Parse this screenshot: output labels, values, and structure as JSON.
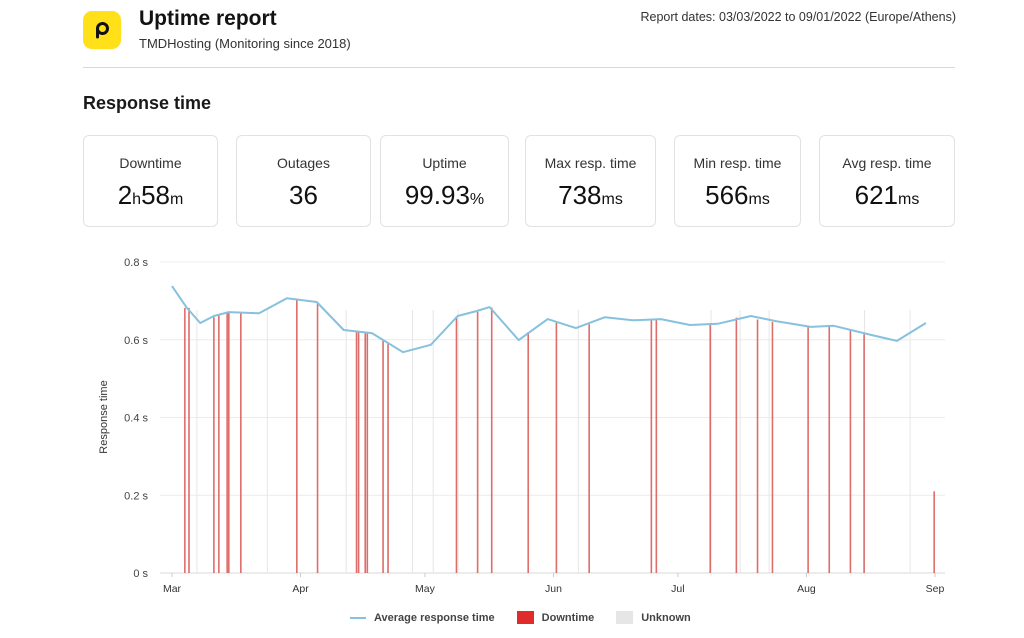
{
  "header": {
    "logo_icon": "pingdom-p-logo-icon",
    "title": "Uptime report",
    "subtitle": "TMDHosting (Monitoring since 2018)",
    "report_dates": "Report dates: 03/03/2022 to 09/01/2022 (Europe/Athens)"
  },
  "section_title": "Response time",
  "cards": [
    {
      "label": "Downtime",
      "parts": [
        {
          "v": "2",
          "u": false
        },
        {
          "v": "h",
          "u": true
        },
        {
          "v": "58",
          "u": false
        },
        {
          "v": "m",
          "u": true
        }
      ]
    },
    {
      "label": "Outages",
      "parts": [
        {
          "v": "36",
          "u": false
        }
      ]
    },
    {
      "label": "Uptime",
      "parts": [
        {
          "v": "99.93",
          "u": false
        },
        {
          "v": "%",
          "u": true
        }
      ]
    },
    {
      "label": "Max resp. time",
      "parts": [
        {
          "v": "738",
          "u": false
        },
        {
          "v": "ms",
          "u": true
        }
      ]
    },
    {
      "label": "Min resp. time",
      "parts": [
        {
          "v": "566",
          "u": false
        },
        {
          "v": "ms",
          "u": true
        }
      ]
    },
    {
      "label": "Avg resp. time",
      "parts": [
        {
          "v": "621",
          "u": false
        },
        {
          "v": "ms",
          "u": true
        }
      ]
    }
  ],
  "colors": {
    "line": "#86c1de",
    "downtime": "#d9534f",
    "downtime_legend": "#e02b2b",
    "unknown": "#e6e6e6",
    "logo": "#ffe019"
  },
  "chart_data": {
    "type": "line",
    "title": "Response time",
    "xlabel": "",
    "ylabel": "Response time",
    "ylim": [
      0,
      0.8
    ],
    "yticks": [
      0,
      0.2,
      0.4,
      0.6,
      0.8
    ],
    "ytick_labels": [
      "0 s",
      "0.2 s",
      "0.4 s",
      "0.6 s",
      "0.8 s"
    ],
    "xlim_days_from_mar1": [
      -3,
      187
    ],
    "xticks": [
      {
        "label": "Mar",
        "day": 0
      },
      {
        "label": "Apr",
        "day": 31
      },
      {
        "label": "May",
        "day": 61
      },
      {
        "label": "Jun",
        "day": 92
      },
      {
        "label": "Jul",
        "day": 122
      },
      {
        "label": "Aug",
        "day": 153
      },
      {
        "label": "Sep",
        "day": 184
      }
    ],
    "grid": true,
    "legend_position": "bottom",
    "legend": [
      "Average response time",
      "Downtime",
      "Unknown"
    ],
    "series": [
      {
        "name": "Average response time",
        "points_day_seconds": [
          [
            0,
            0.738
          ],
          [
            3.6,
            0.682
          ],
          [
            6.8,
            0.643
          ],
          [
            10.1,
            0.661
          ],
          [
            13.7,
            0.671
          ],
          [
            21,
            0.668
          ],
          [
            27.7,
            0.707
          ],
          [
            34.9,
            0.697
          ],
          [
            41.4,
            0.625
          ],
          [
            48.2,
            0.617
          ],
          [
            55.7,
            0.568
          ],
          [
            62.4,
            0.587
          ],
          [
            68.9,
            0.661
          ],
          [
            73.5,
            0.674
          ],
          [
            76.6,
            0.684
          ],
          [
            83.6,
            0.599
          ],
          [
            90.6,
            0.653
          ],
          [
            97.4,
            0.63
          ],
          [
            104.4,
            0.658
          ],
          [
            111.1,
            0.65
          ],
          [
            117.9,
            0.653
          ],
          [
            124.9,
            0.638
          ],
          [
            131.6,
            0.641
          ],
          [
            139.6,
            0.661
          ],
          [
            145.6,
            0.648
          ],
          [
            154.1,
            0.633
          ],
          [
            159.6,
            0.636
          ],
          [
            168.8,
            0.612
          ],
          [
            174.8,
            0.597
          ],
          [
            181.8,
            0.643
          ]
        ]
      }
    ],
    "downtime_events_day": [
      3.1,
      4.1,
      10.1,
      11.3,
      13.3,
      13.7,
      16.6,
      30.1,
      35.1,
      44.5,
      45,
      46.6,
      47.1,
      50.9,
      52.1,
      68.6,
      73.7,
      77.1,
      85.9,
      92.7,
      100.6,
      115.6,
      116.8,
      129.8,
      136.1,
      141.2,
      144.8,
      153.4,
      158.5,
      163.6,
      166.9,
      183.8
    ],
    "downtime_heights_seconds": [
      0.682,
      0.682,
      0.658,
      0.663,
      0.671,
      0.671,
      0.67,
      0.704,
      0.697,
      0.62,
      0.619,
      0.617,
      0.617,
      0.6,
      0.593,
      0.66,
      0.672,
      0.683,
      0.62,
      0.645,
      0.64,
      0.653,
      0.653,
      0.643,
      0.657,
      0.652,
      0.646,
      0.633,
      0.634,
      0.625,
      0.614,
      0.21
    ],
    "unknown_events_day": [
      6,
      23,
      42,
      58,
      63,
      69,
      98,
      130,
      137,
      144,
      167,
      178
    ]
  },
  "legend": {
    "line_label": "Average response time",
    "downtime_label": "Downtime",
    "unknown_label": "Unknown"
  }
}
